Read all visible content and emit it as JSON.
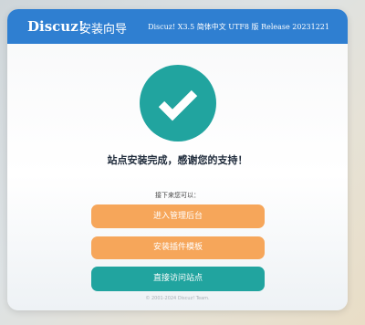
{
  "header": {
    "brand": "Discuz!",
    "title": "安装向导",
    "version": "Discuz! X3.5 简体中文 UTF8 版 Release 20231221"
  },
  "status": {
    "icon": "checkmark-icon",
    "message": "站点安装完成，感谢您的支持！"
  },
  "next_steps": {
    "prompt": "接下来您可以：",
    "buttons": {
      "admin": "进入管理后台",
      "plugins": "安装插件模板",
      "visit": "直接访问站点"
    }
  },
  "footer": {
    "copyright": "© 2001-2024 Discuz! Team."
  },
  "colors": {
    "header": "#2f7fd1",
    "accent_teal": "#21a49f",
    "accent_orange": "#f6a65a"
  }
}
